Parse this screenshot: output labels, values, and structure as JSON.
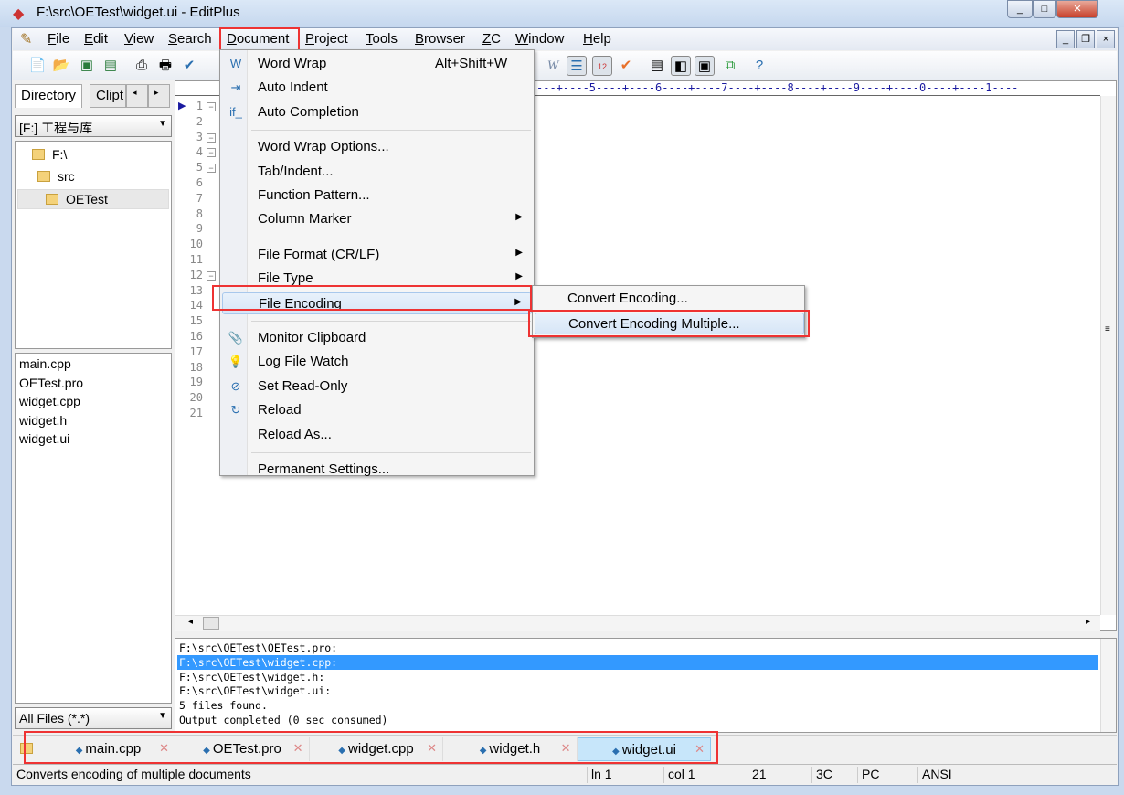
{
  "window": {
    "title": "F:\\src\\OETest\\widget.ui - EditPlus",
    "minimize": "_",
    "maximize": "□",
    "close": "×",
    "mdi_min": "_",
    "mdi_restore": "❐",
    "mdi_close": "×"
  },
  "menubar": [
    {
      "label": "File",
      "u": "F",
      "rest": "ile"
    },
    {
      "label": "Edit",
      "u": "E",
      "rest": "dit"
    },
    {
      "label": "View",
      "u": "V",
      "rest": "iew"
    },
    {
      "label": "Search",
      "u": "S",
      "rest": "earch"
    },
    {
      "label": "Document",
      "u": "D",
      "rest": "ocument"
    },
    {
      "label": "Project",
      "u": "P",
      "rest": "roject"
    },
    {
      "label": "Tools",
      "u": "T",
      "rest": "ools"
    },
    {
      "label": "Browser",
      "u": "B",
      "rest": "rowser"
    },
    {
      "label": "ZC",
      "u": "Z",
      "rest": "C"
    },
    {
      "label": "Window",
      "u": "W",
      "rest": "indow"
    },
    {
      "label": "Help",
      "u": "H",
      "rest": "elp"
    }
  ],
  "left": {
    "tabs": [
      "Directory",
      "Clipt"
    ],
    "drive": "[F:] 工程与库",
    "tree": [
      "F:\\",
      "src",
      "OETest"
    ],
    "files": [
      "main.cpp",
      "OETest.pro",
      "widget.cpp",
      "widget.h",
      "widget.ui"
    ],
    "filter": "All Files (*.*)"
  },
  "editor": {
    "ruler": "---+----5----+----6----+----7----+----8----+----9----+----0----+----1----",
    "line_count": 21,
    "fold_lines": [
      1,
      3,
      4,
      5,
      12
    ]
  },
  "document_menu": [
    {
      "label": "Word Wrap",
      "shortcut": "Alt+Shift+W",
      "icon": "word-wrap-icon",
      "glyph": "W"
    },
    {
      "label": "Auto Indent",
      "icon": "auto-indent-icon",
      "glyph": "⇥"
    },
    {
      "label": "Auto Completion",
      "icon": "auto-completion-icon",
      "glyph": "if_"
    },
    {
      "sep": true
    },
    {
      "label": "Word Wrap Options..."
    },
    {
      "label": "Tab/Indent..."
    },
    {
      "label": "Function Pattern..."
    },
    {
      "label": "Column Marker",
      "submenu": true
    },
    {
      "sep": true
    },
    {
      "label": "File Format (CR/LF)",
      "submenu": true
    },
    {
      "label": "File Type",
      "submenu": true
    },
    {
      "label": "File Encoding",
      "submenu": true,
      "highlighted": true
    },
    {
      "sep": true
    },
    {
      "label": "Monitor Clipboard",
      "icon": "clipboard-icon",
      "glyph": "📎"
    },
    {
      "label": "Log File Watch",
      "icon": "lightbulb-icon",
      "glyph": "💡"
    },
    {
      "label": "Set Read-Only",
      "icon": "read-only-icon",
      "glyph": "⊘"
    },
    {
      "label": "Reload",
      "icon": "reload-icon",
      "glyph": "↻"
    },
    {
      "label": "Reload As..."
    },
    {
      "sep": true
    },
    {
      "label": "Permanent Settings..."
    }
  ],
  "encoding_submenu": [
    {
      "label": "Convert Encoding..."
    },
    {
      "label": "Convert Encoding Multiple...",
      "highlighted": true
    }
  ],
  "output": [
    "F:\\src\\OETest\\OETest.pro:",
    "F:\\src\\OETest\\widget.cpp:",
    "F:\\src\\OETest\\widget.h:",
    "F:\\src\\OETest\\widget.ui:",
    "5 files found.",
    "Output completed (0 sec consumed)"
  ],
  "output_selected": 1,
  "doc_tabs": [
    "main.cpp",
    "OETest.pro",
    "widget.cpp",
    "widget.h",
    "widget.ui"
  ],
  "active_tab": 4,
  "status": {
    "message": "Converts encoding of multiple documents",
    "line": "ln 1",
    "col": "col 1",
    "lines": "21",
    "hex": "3C",
    "format": "PC",
    "encoding": "ANSI"
  },
  "colors": {
    "highlight_box": "#ee3333",
    "selection": "#3399ff",
    "active_tab": "#c7e6fa"
  }
}
